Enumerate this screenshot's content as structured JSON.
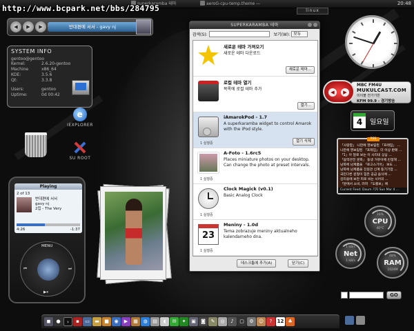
{
  "url_overlay": "http://www.bcpark.net/bbs/284795",
  "top_panel": {
    "tasks": [
      "superkaramba 테마",
      "aeroG-cpu-temp.theme —"
    ],
    "clock": "20:48",
    "linux_logo": "linux"
  },
  "media_bar": {
    "song": "반대편에 서서 - gavy nj"
  },
  "system_info": {
    "title": "SYSTEM INFO",
    "user_host": "gentoo@gentoo",
    "rows": [
      {
        "k": "Kernel:",
        "v": "2.6.20-gentoo"
      },
      {
        "k": "Machine",
        "v": "x86_64"
      },
      {
        "k": "KDE:",
        "v": "3.5.6"
      },
      {
        "k": "Qt:",
        "v": "3.3.8"
      }
    ],
    "users_label": "Users:",
    "users_value": "gentoo",
    "uptime_label": "Uptime:",
    "uptime_value": "0d 00:42"
  },
  "desktop_icons": {
    "iexplorer": "IEXPLORER",
    "suroot": "SU ROOT"
  },
  "ipod": {
    "header": "Playing",
    "count": "2 of 13",
    "title": "반대편에 서서",
    "artist": "gavy nj",
    "album": "2집 - The Very",
    "progress": 0.45,
    "elapsed": "4:26",
    "remaining": "-1:37",
    "menu": "MENU",
    "prev": "⏮",
    "next": "⏭",
    "play": "▶⏸"
  },
  "dialog": {
    "title": "SUPERKARAMBA 테마",
    "search_label": "검색(S):",
    "search_value": "",
    "view_label": "보기(W):",
    "view_value": "모두",
    "items": [
      {
        "name": "새로운 테마 가져오기",
        "desc": "새로운 테마 다운로드",
        "installed": "",
        "button": "새로운 테마..."
      },
      {
        "name": "로컬 테마 열기",
        "desc": "목록에 로컬 테마 추가",
        "installed": "",
        "button": "열기..."
      },
      {
        "name": "iAmarokPod - 1.7",
        "desc": "A superkaramba widget to control Amarok with the iPod style.",
        "installed": "1 실행중",
        "button": "열기 삭제"
      },
      {
        "name": "A-Foto - 1.6rc5",
        "desc": "Places miniature photos on your desktop. Can change the photo at preset intervals.",
        "installed": "1 실행중",
        "button": ""
      },
      {
        "name": "Clock Magick (v0.1)",
        "desc": "Basic Analog Clock",
        "installed": "1 실행중",
        "button": ""
      },
      {
        "name": "Meniny - 1.0d",
        "desc": "Tema zobrazuje meniny aktualneho kalendarneho dna.",
        "installed": "1 실행중",
        "button": ""
      }
    ],
    "add_to_desktop": "데스크톱에 추가(A)",
    "close": "닫기(C)"
  },
  "radio": {
    "line1": "MBC FM4U",
    "line2": "MUKULCAST.COM",
    "line3": "이이블 전가기반",
    "line4": "KFM 99.9 - 경기방송"
  },
  "calendar": {
    "date": "4",
    "weekday": "일요일"
  },
  "rss": {
    "tag": "RSS",
    "lines": [
      "「사랑함」 니란에 영보림된 「프레임」 ...",
      "니란에 영보림된 「프레임」 더 이상 판매 ...",
      "「1」아 달로 보는 이 사리네 상삼 ...",
      "「음악관전 문화」 동생 거유아에 빈정해 ...",
      "남쪽에 남제품을 「로고스기어」 보도 ...",
      "남쪽에 남제품을 진원관 신계 등기기업 ...",
      "국민다른 원형이 힘은 공급 음식에 ...",
      "김리용에 보란 피로 씨는 시어의 ...",
      "「분에서 소비, 러피 「도를보」에"
    ],
    "footer": "Current Feed: Daum 기자 Sun Mar 4 ..."
  },
  "gauges": {
    "cpu": {
      "label": "CPU",
      "value": "16%",
      "sub": "40°C"
    },
    "net": {
      "label": "Net",
      "up": "1 kB/s",
      "down": "1 kB/s"
    },
    "ram": {
      "label": "RAM",
      "value": "48%",
      "sub": "1024M"
    }
  },
  "search_widget": {
    "go": "GO"
  },
  "dock": {
    "calendar_day": "12"
  }
}
